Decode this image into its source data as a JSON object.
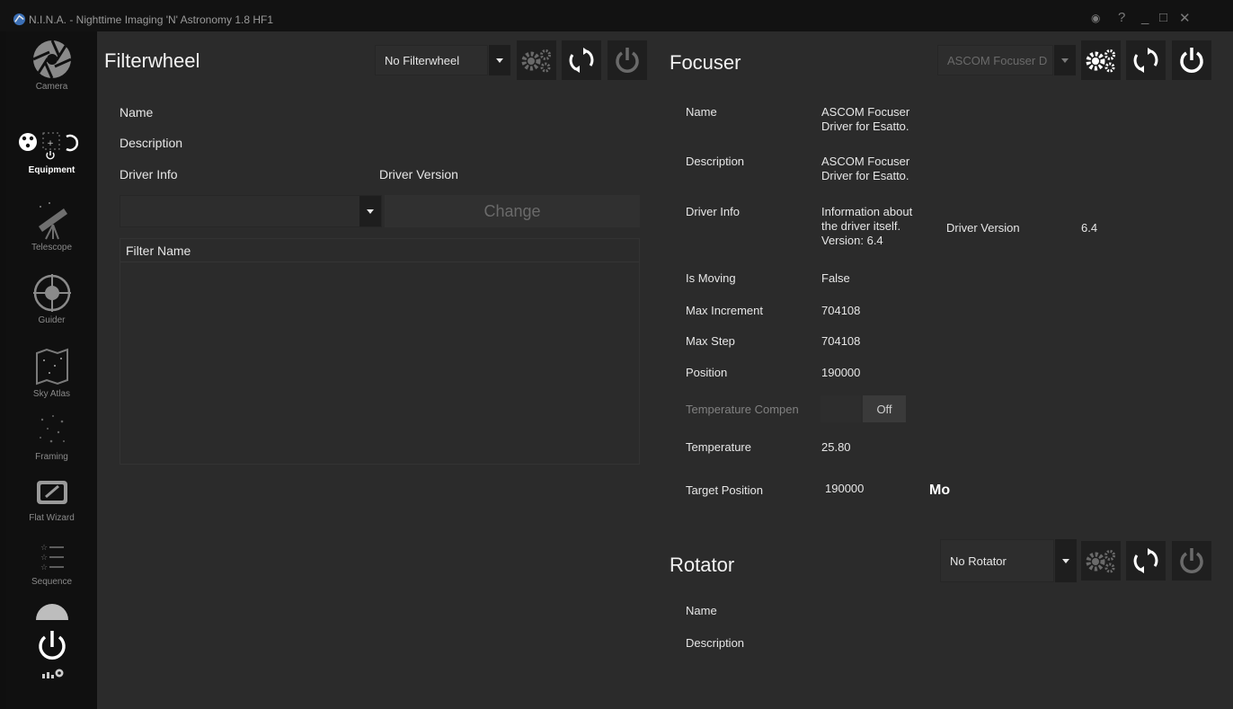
{
  "window": {
    "title": "N.I.N.A. - Nighttime Imaging 'N' Astronomy 1.8 HF1"
  },
  "sidebar": {
    "items": [
      {
        "label": "Camera",
        "icon": "camera-aperture-icon"
      },
      {
        "label": "Equipment",
        "icon": "equipment-icon",
        "active": true
      },
      {
        "label": "Telescope",
        "icon": "telescope-icon"
      },
      {
        "label": "Guider",
        "icon": "crosshair-icon"
      },
      {
        "label": "Sky Atlas",
        "icon": "sky-map-icon"
      },
      {
        "label": "Framing",
        "icon": "stars-icon"
      },
      {
        "label": "Flat Wizard",
        "icon": "flat-panel-icon"
      },
      {
        "label": "Sequence",
        "icon": "list-icon"
      }
    ]
  },
  "filterwheel": {
    "title": "Filterwheel",
    "device": "No Filterwheel",
    "name_label": "Name",
    "description_label": "Description",
    "driver_info_label": "Driver Info",
    "driver_version_label": "Driver Version",
    "change_label": "Change",
    "filter_name_header": "Filter Name"
  },
  "focuser": {
    "title": "Focuser",
    "device": "ASCOM Focuser D",
    "name_label": "Name",
    "name_value": "ASCOM Focuser\nDriver for Esatto.",
    "description_label": "Description",
    "description_value": "ASCOM Focuser\nDriver for Esatto.",
    "driver_info_label": "Driver Info",
    "driver_info_value": "Information about\nthe driver itself.\nVersion: 6.4",
    "driver_version_label": "Driver Version",
    "driver_version_value": "6.4",
    "is_moving_label": "Is Moving",
    "is_moving_value": "False",
    "max_increment_label": "Max Increment",
    "max_increment_value": "704108",
    "max_step_label": "Max Step",
    "max_step_value": "704108",
    "position_label": "Position",
    "position_value": "190000",
    "temp_comp_label": "Temperature Compen",
    "temp_comp_value": "Off",
    "temperature_label": "Temperature",
    "temperature_value": "25.80",
    "target_position_label": "Target Position",
    "target_position_value": "190000",
    "move_label": "Mo"
  },
  "rotator": {
    "title": "Rotator",
    "device": "No Rotator",
    "name_label": "Name",
    "description_label": "Description"
  },
  "colors": {
    "background": "#2b2b2b",
    "sidebar": "#101010",
    "button": "#1f1f1f",
    "text": "#e6e6e6",
    "dim": "#6a6a6a"
  }
}
